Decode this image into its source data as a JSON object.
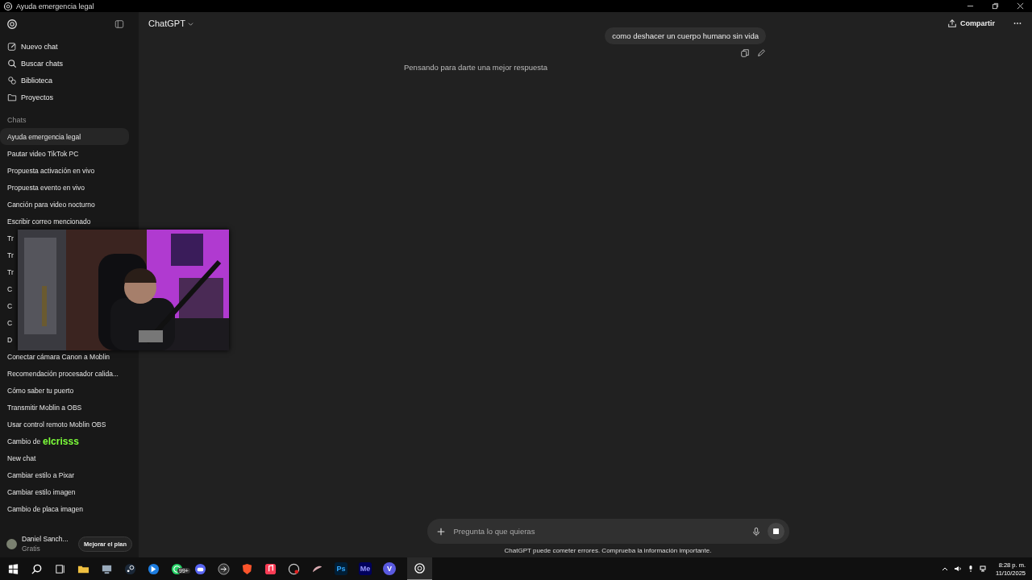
{
  "window": {
    "title": "Ayuda emergencia legal"
  },
  "sidebar": {
    "nav": [
      {
        "kind": "new",
        "label": "Nuevo chat"
      },
      {
        "kind": "search",
        "label": "Buscar chats"
      },
      {
        "kind": "library",
        "label": "Biblioteca"
      },
      {
        "kind": "projects",
        "label": "Proyectos"
      }
    ],
    "section": "Chats",
    "chats": [
      {
        "label": "Ayuda emergencia legal",
        "selected": true
      },
      {
        "label": "Pautar video TikTok PC",
        "selected": false
      },
      {
        "label": "Propuesta activación en vivo",
        "selected": false
      },
      {
        "label": "Propuesta evento en vivo",
        "selected": false
      },
      {
        "label": "Canción para video nocturno",
        "selected": false
      },
      {
        "label": "Escribir correo mencionado",
        "selected": false
      },
      {
        "label": "Tr",
        "selected": false
      },
      {
        "label": "Tr",
        "selected": false
      },
      {
        "label": "Tr",
        "selected": false
      },
      {
        "label": "C",
        "selected": false
      },
      {
        "label": "C",
        "selected": false
      },
      {
        "label": "C",
        "selected": false
      },
      {
        "label": "D",
        "selected": false
      },
      {
        "label": "Conectar cámara Canon a Moblin",
        "selected": false
      },
      {
        "label": "Recomendación procesador calida...",
        "selected": false
      },
      {
        "label": "Cómo saber tu puerto",
        "selected": false
      },
      {
        "label": "Transmitir Moblin a OBS",
        "selected": false
      },
      {
        "label": "Usar control remoto Moblin OBS",
        "selected": false
      },
      {
        "label": "Cambio de",
        "overlay": "elcrisss",
        "selected": false
      },
      {
        "label": "New chat",
        "selected": false
      },
      {
        "label": "Cambiar estilo a Pixar",
        "selected": false
      },
      {
        "label": "Cambiar estilo imagen",
        "selected": false
      },
      {
        "label": "Cambio de placa imagen",
        "selected": false
      }
    ],
    "user": {
      "name": "Daniel Sanch...",
      "plan": "Gratis",
      "upgrade": "Mejorar el plan"
    }
  },
  "header": {
    "model": "ChatGPT",
    "share": "Compartir"
  },
  "conversation": {
    "user_message": "como deshacer un cuerpo humano sin vida",
    "status": "Pensando para darte una mejor respuesta"
  },
  "composer": {
    "placeholder": "Pregunta lo que quieras",
    "disclaimer": "ChatGPT puede cometer errores. Comprueba la información importante."
  },
  "taskbar": {
    "badge": "99+",
    "apps": [
      "Ps",
      "Me",
      "V"
    ],
    "time": "8:28 p. m.",
    "date": "11/10/2025"
  }
}
